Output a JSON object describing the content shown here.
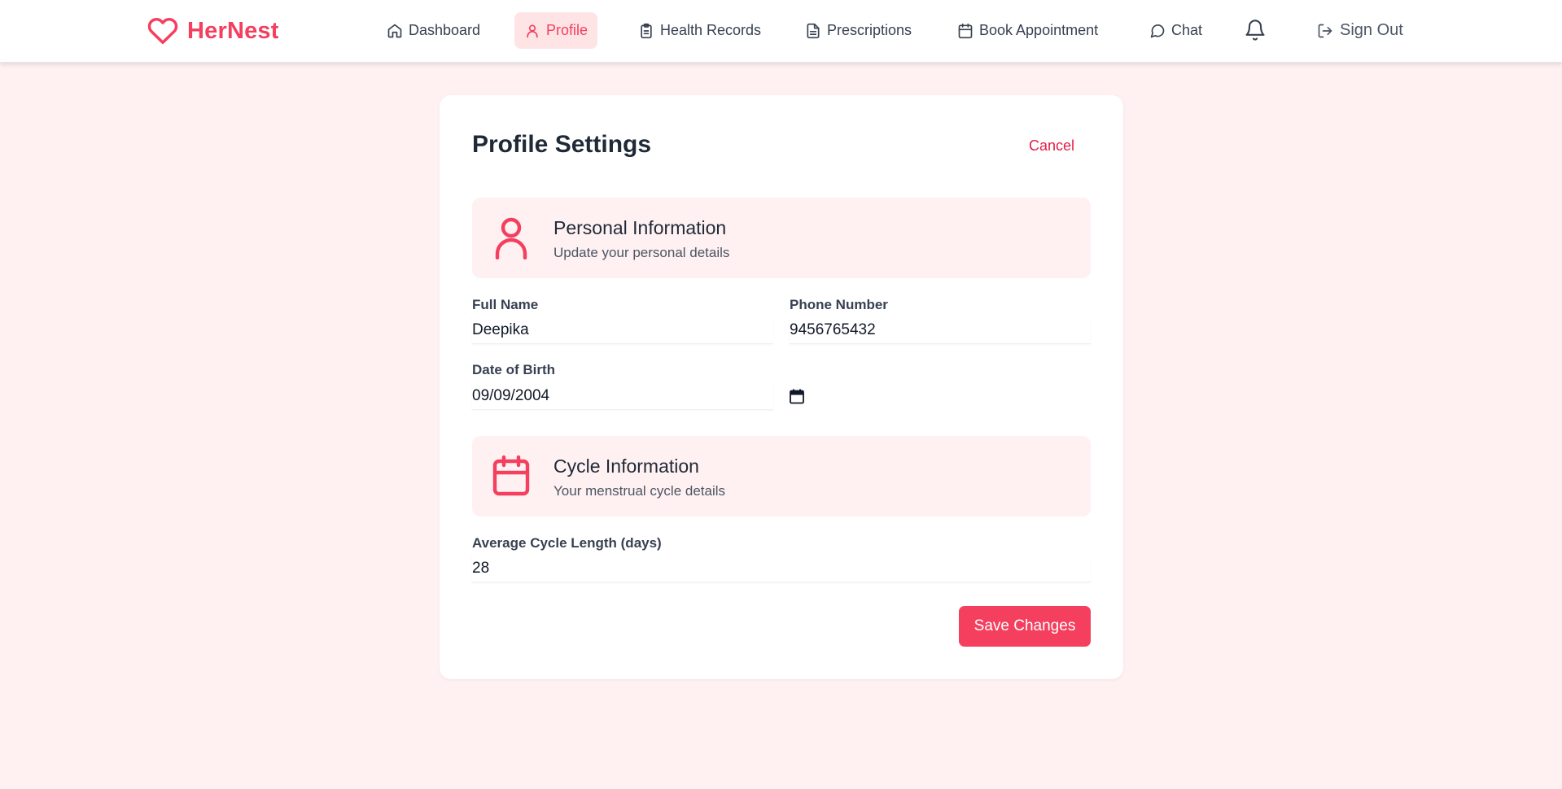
{
  "brand": {
    "name": "HerNest",
    "accent": "#f43f5e"
  },
  "nav": {
    "items": [
      {
        "label": "Dashboard",
        "icon": "home-icon"
      },
      {
        "label": "Profile",
        "icon": "user-icon",
        "active": true
      },
      {
        "label": "Health Records",
        "icon": "clipboard-icon"
      },
      {
        "label": "Prescriptions",
        "icon": "file-text-icon"
      },
      {
        "label": "Book Appointment",
        "icon": "calendar-icon"
      },
      {
        "label": "Chat",
        "icon": "message-circle-icon"
      }
    ],
    "notifications_icon": "bell-icon",
    "signout_label": "Sign Out"
  },
  "profile": {
    "title": "Profile Settings",
    "cancel_label": "Cancel",
    "personal": {
      "title": "Personal Information",
      "subtitle": "Update your personal details",
      "icon": "user-icon"
    },
    "fields": {
      "full_name": {
        "label": "Full Name",
        "value": "Deepika"
      },
      "phone": {
        "label": "Phone Number",
        "value": "9456765432"
      },
      "dob": {
        "label": "Date of Birth",
        "value": "09/09/2004"
      },
      "cycle_length": {
        "label": "Average Cycle Length (days)",
        "value": "28"
      }
    },
    "cycle": {
      "title": "Cycle Information",
      "subtitle": "Your menstrual cycle details",
      "icon": "calendar-icon"
    },
    "save_label": "Save Changes"
  }
}
